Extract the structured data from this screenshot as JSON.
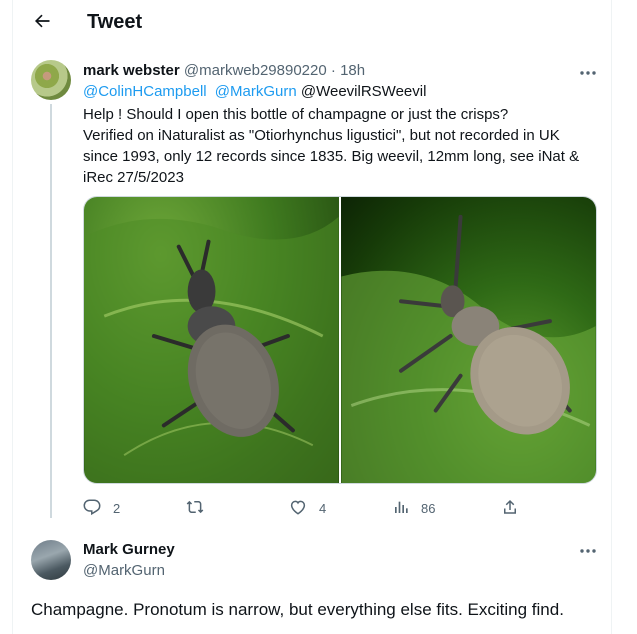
{
  "header": {
    "back_icon": "arrow-left-icon",
    "title": "Tweet"
  },
  "tweet": {
    "author_name": "mark webster",
    "author_handle": "@markweb29890220",
    "separator": "·",
    "time": "18h",
    "mentions": [
      "@ColinHCampbell",
      "@MarkGurn",
      "@WeevilRSWeevil"
    ],
    "text_lines": [
      "Help ! Should I open this bottle of champagne or just the  crisps?",
      "Verified on iNaturalist as \"Otiorhynchus ligustici\", but not recorded in UK",
      "since 1993, only 12 records since 1835. Big weevil, 12mm long, see iNat &",
      "iRec 27/5/2023"
    ],
    "more_icon": "more-dots-icon",
    "actions": {
      "reply": {
        "icon": "reply-icon",
        "count": "2"
      },
      "retweet": {
        "icon": "retweet-icon",
        "count": ""
      },
      "like": {
        "icon": "heart-icon",
        "count": "4"
      },
      "views": {
        "icon": "views-chart-icon",
        "count": "86"
      },
      "share": {
        "icon": "share-icon",
        "count": ""
      }
    },
    "media_icons": [
      "weevil-photo-1",
      "weevil-photo-2"
    ]
  },
  "reply": {
    "author_name": "Mark Gurney",
    "author_handle": "@MarkGurn",
    "text": "Champagne. Pronotum is narrow, but everything else fits. Exciting find.",
    "more_icon": "more-dots-icon"
  },
  "colors": {
    "link": "#1d9bf0",
    "secondary": "#536471",
    "primary_text": "#0f1419",
    "border": "#cfd9de"
  }
}
